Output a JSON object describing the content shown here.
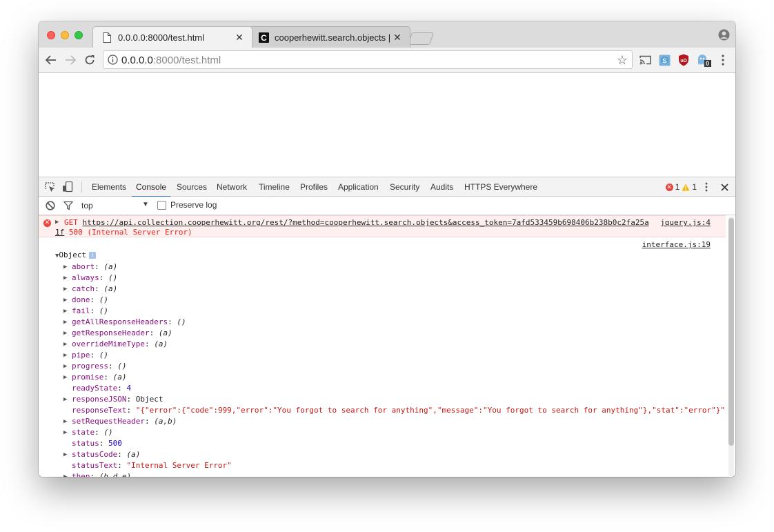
{
  "browser": {
    "tabs": [
      {
        "title": "0.0.0.0:8000/test.html",
        "active": true,
        "favicon": "page-icon"
      },
      {
        "title": "cooperhewitt.search.objects | ",
        "active": false,
        "favicon": "cooper-hewitt-c-icon"
      }
    ],
    "address": {
      "host": "0.0.0.0",
      "rest": ":8000/test.html"
    },
    "extensions": [
      "cast-icon",
      "skype-icon",
      "ublock-icon",
      "ghostery-icon"
    ],
    "ghostery_badge": "0"
  },
  "devtools": {
    "tabs": [
      "Elements",
      "Console",
      "Sources",
      "Network",
      "Timeline",
      "Profiles",
      "Application",
      "Security",
      "Audits",
      "HTTPS Everywhere"
    ],
    "active_tab": "Console",
    "error_count": "1",
    "warning_count": "1",
    "context": "top",
    "preserve_log_label": "Preserve log"
  },
  "console": {
    "error": {
      "method": "GET",
      "url_line1": "https://api.collection.cooperhewitt.org/rest/?method=cooperhewitt.search.objects&access_token=7afd533459b698406b238b0c2fa25a",
      "url_line2": "1f",
      "status": "500 (Internal Server Error)",
      "source": "jquery.js:4"
    },
    "log_source": "interface.js:19",
    "object_label": "Object",
    "properties": [
      {
        "key": "abort",
        "value": "(a)",
        "kind": "fn",
        "expandable": true
      },
      {
        "key": "always",
        "value": "()",
        "kind": "fn",
        "expandable": true
      },
      {
        "key": "catch",
        "value": "(a)",
        "kind": "fn",
        "expandable": true
      },
      {
        "key": "done",
        "value": "()",
        "kind": "fn",
        "expandable": true
      },
      {
        "key": "fail",
        "value": "()",
        "kind": "fn",
        "expandable": true
      },
      {
        "key": "getAllResponseHeaders",
        "value": "()",
        "kind": "fn",
        "expandable": true
      },
      {
        "key": "getResponseHeader",
        "value": "(a)",
        "kind": "fn",
        "expandable": true
      },
      {
        "key": "overrideMimeType",
        "value": "(a)",
        "kind": "fn",
        "expandable": true
      },
      {
        "key": "pipe",
        "value": "()",
        "kind": "fn",
        "expandable": true
      },
      {
        "key": "progress",
        "value": "()",
        "kind": "fn",
        "expandable": true
      },
      {
        "key": "promise",
        "value": "(a)",
        "kind": "fn",
        "expandable": true
      },
      {
        "key": "readyState",
        "value": "4",
        "kind": "num",
        "expandable": false
      },
      {
        "key": "responseJSON",
        "value": "Object",
        "kind": "plain",
        "expandable": true
      },
      {
        "key": "responseText",
        "value": "\"{\"error\":{\"code\":999,\"error\":\"You forgot to search for anything\",\"message\":\"You forgot to search for anything\"},\"stat\":\"error\"}\"",
        "kind": "str",
        "expandable": false
      },
      {
        "key": "setRequestHeader",
        "value": "(a,b)",
        "kind": "fn",
        "expandable": true
      },
      {
        "key": "state",
        "value": "()",
        "kind": "fn",
        "expandable": true
      },
      {
        "key": "status",
        "value": "500",
        "kind": "num",
        "expandable": false
      },
      {
        "key": "statusCode",
        "value": "(a)",
        "kind": "fn",
        "expandable": true
      },
      {
        "key": "statusText",
        "value": "\"Internal Server Error\"",
        "kind": "str",
        "expandable": false
      },
      {
        "key": "then",
        "value": "(b,d,e)",
        "kind": "fn",
        "expandable": true
      }
    ]
  }
}
